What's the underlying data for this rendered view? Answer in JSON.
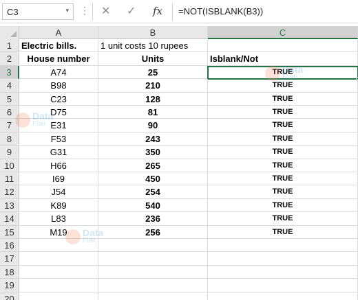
{
  "formula_bar": {
    "name_box": "C3",
    "name_box_arrow": "▾",
    "more_dots": "⋮",
    "cancel_icon": "✕",
    "enter_icon": "✓",
    "fx_label": "fx",
    "formula": "=NOT(ISBLANK(B3))"
  },
  "columns": [
    "A",
    "B",
    "C"
  ],
  "selected_column": "C",
  "selected_cell": "C3",
  "rows": [
    {
      "num": "1",
      "a": "Electric bills.",
      "b": "1 unit costs 10 rupees",
      "c": ""
    },
    {
      "num": "2",
      "a": "House number",
      "b": "Units",
      "c": "Isblank/Not"
    },
    {
      "num": "3",
      "a": "A74",
      "b": "25",
      "c": "TRUE"
    },
    {
      "num": "4",
      "a": "B98",
      "b": "210",
      "c": "TRUE"
    },
    {
      "num": "5",
      "a": "C23",
      "b": "128",
      "c": "TRUE"
    },
    {
      "num": "6",
      "a": "D75",
      "b": "81",
      "c": "TRUE"
    },
    {
      "num": "7",
      "a": "E31",
      "b": "90",
      "c": "TRUE"
    },
    {
      "num": "8",
      "a": "F53",
      "b": "243",
      "c": "TRUE"
    },
    {
      "num": "9",
      "a": "G31",
      "b": "350",
      "c": "TRUE"
    },
    {
      "num": "10",
      "a": "H66",
      "b": "265",
      "c": "TRUE"
    },
    {
      "num": "11",
      "a": "I69",
      "b": "450",
      "c": "TRUE"
    },
    {
      "num": "12",
      "a": "J54",
      "b": "254",
      "c": "TRUE"
    },
    {
      "num": "13",
      "a": "K89",
      "b": "540",
      "c": "TRUE"
    },
    {
      "num": "14",
      "a": "L83",
      "b": "236",
      "c": "TRUE"
    },
    {
      "num": "15",
      "a": "M19",
      "b": "256",
      "c": "TRUE"
    },
    {
      "num": "16",
      "a": "",
      "b": "",
      "c": ""
    },
    {
      "num": "17",
      "a": "",
      "b": "",
      "c": ""
    },
    {
      "num": "18",
      "a": "",
      "b": "",
      "c": ""
    },
    {
      "num": "19",
      "a": "",
      "b": "",
      "c": ""
    },
    {
      "num": "20",
      "a": "",
      "b": "",
      "c": ""
    }
  ],
  "watermark": {
    "line1": "Data",
    "line2": "Flair"
  },
  "colors": {
    "accent": "#217346",
    "watermark_circle": "#f27c52",
    "watermark_text": "#2a8fd6"
  }
}
